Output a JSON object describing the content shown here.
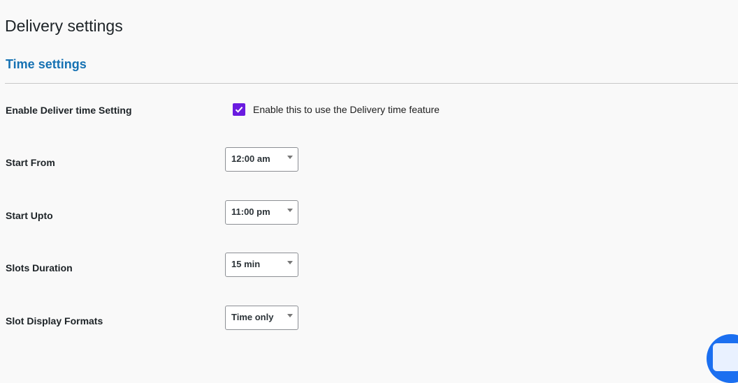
{
  "page": {
    "title": "Delivery settings"
  },
  "section": {
    "title": "Time settings"
  },
  "rows": {
    "enable": {
      "label": "Enable Deliver time Setting",
      "checkbox_checked": true,
      "checkbox_text": "Enable this to use the Delivery time feature"
    },
    "start_from": {
      "label": "Start From",
      "value": "12:00 am"
    },
    "start_upto": {
      "label": "Start Upto",
      "value": "11:00 pm"
    },
    "slots_duration": {
      "label": "Slots Duration",
      "value": "15 min"
    },
    "slot_display_formats": {
      "label": "Slot Display Formats",
      "value": "Time only"
    }
  },
  "colors": {
    "accent": "#6a1be0",
    "section_title": "#1672b3",
    "chat_button": "#1b6ff0"
  },
  "icons": {
    "checkbox": "check-icon",
    "dropdown": "caret-down-icon",
    "chat": "chat-icon"
  }
}
